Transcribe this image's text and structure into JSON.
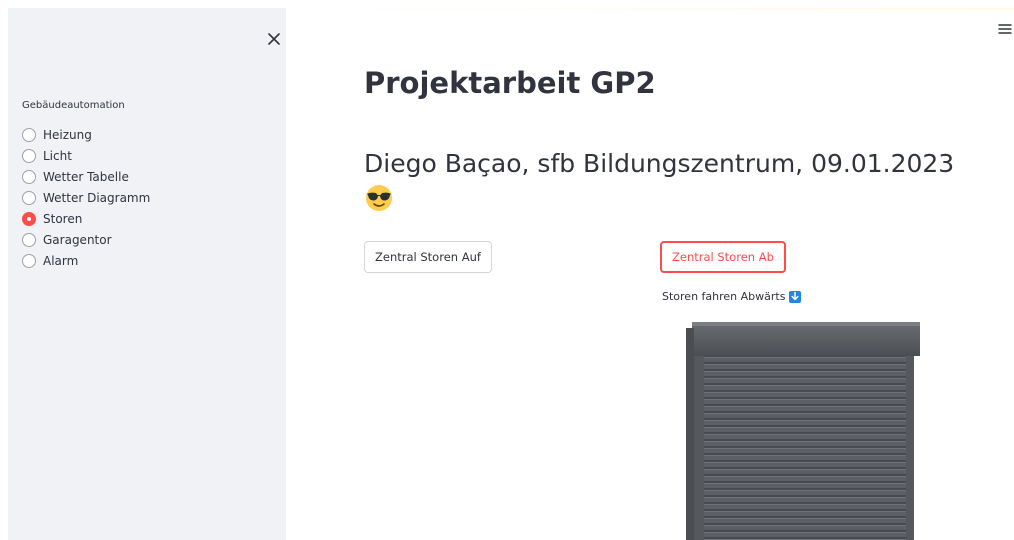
{
  "sidebar": {
    "close_icon": "close-icon",
    "label": "Gebäudeautomation",
    "options": [
      "Heizung",
      "Licht",
      "Wetter Tabelle",
      "Wetter Diagramm",
      "Storen",
      "Garagentor",
      "Alarm"
    ],
    "selected": "Storen",
    "accent_color": "#ff4b4b"
  },
  "header": {
    "menu_icon": "hamburger-icon"
  },
  "main": {
    "title": "Projektarbeit GP2",
    "subtitle": "Diego Baçao, sfb Bildungszentrum, 09.01.2023",
    "emoji": "😎",
    "button_up": "Zentral Storen Auf",
    "button_down": "Zentral Storen Ab",
    "status_text": "Storen fahren Abwärts",
    "status_icon": "arrow-down-icon"
  }
}
